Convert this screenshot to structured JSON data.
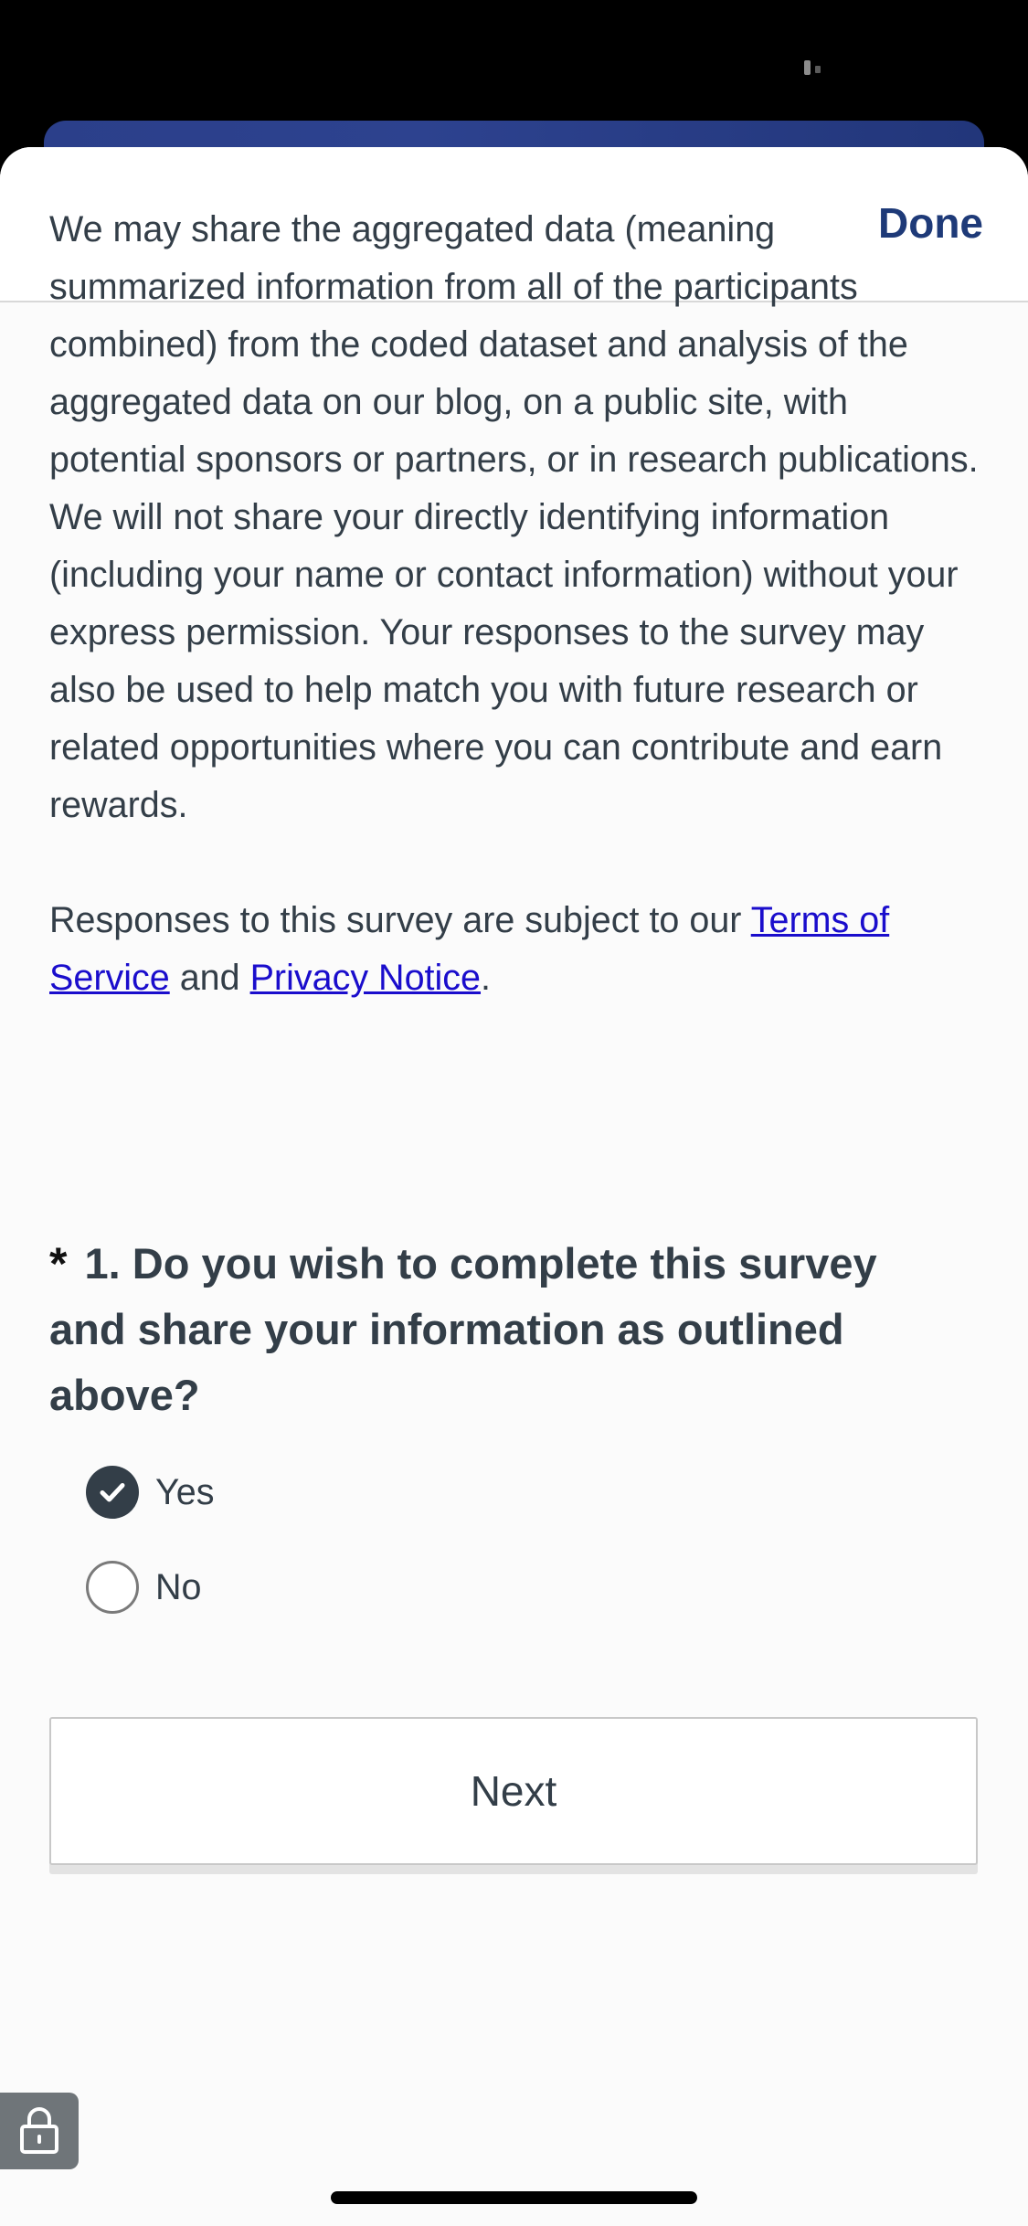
{
  "header": {
    "done_label": "Done"
  },
  "body": {
    "paragraph_1": "We may share the aggregated data (meaning summarized information from all of the participants combined) from the coded dataset and analysis of the aggregated data on our blog, on a public site, with potential sponsors or partners, or in research publications. We will not share your directly identifying information (including your name or contact information) without your express permission. Your responses to the survey may also be used to help match you with future research or related opportunities where you can contribute and earn rewards.",
    "paragraph_2_prefix": "Responses to this survey are subject to our ",
    "terms_link": "Terms of Service",
    "paragraph_2_middle": " and ",
    "privacy_link": "Privacy Notice",
    "paragraph_2_suffix": "."
  },
  "question": {
    "required_marker": "*",
    "text": "1. Do you wish to complete this survey and share your information as outlined above?",
    "options": [
      {
        "label": "Yes",
        "selected": true
      },
      {
        "label": "No",
        "selected": false
      }
    ]
  },
  "next_label": "Next",
  "icons": {
    "status": "status-indicator-icon",
    "check": "checkmark-icon",
    "lock": "lock-icon"
  },
  "colors": {
    "brand_bar": "#2b3f8a",
    "done_text": "#1e3a78",
    "body_text": "#333e48",
    "link": "#1a0dcc",
    "lock_button": "#6f7579"
  }
}
